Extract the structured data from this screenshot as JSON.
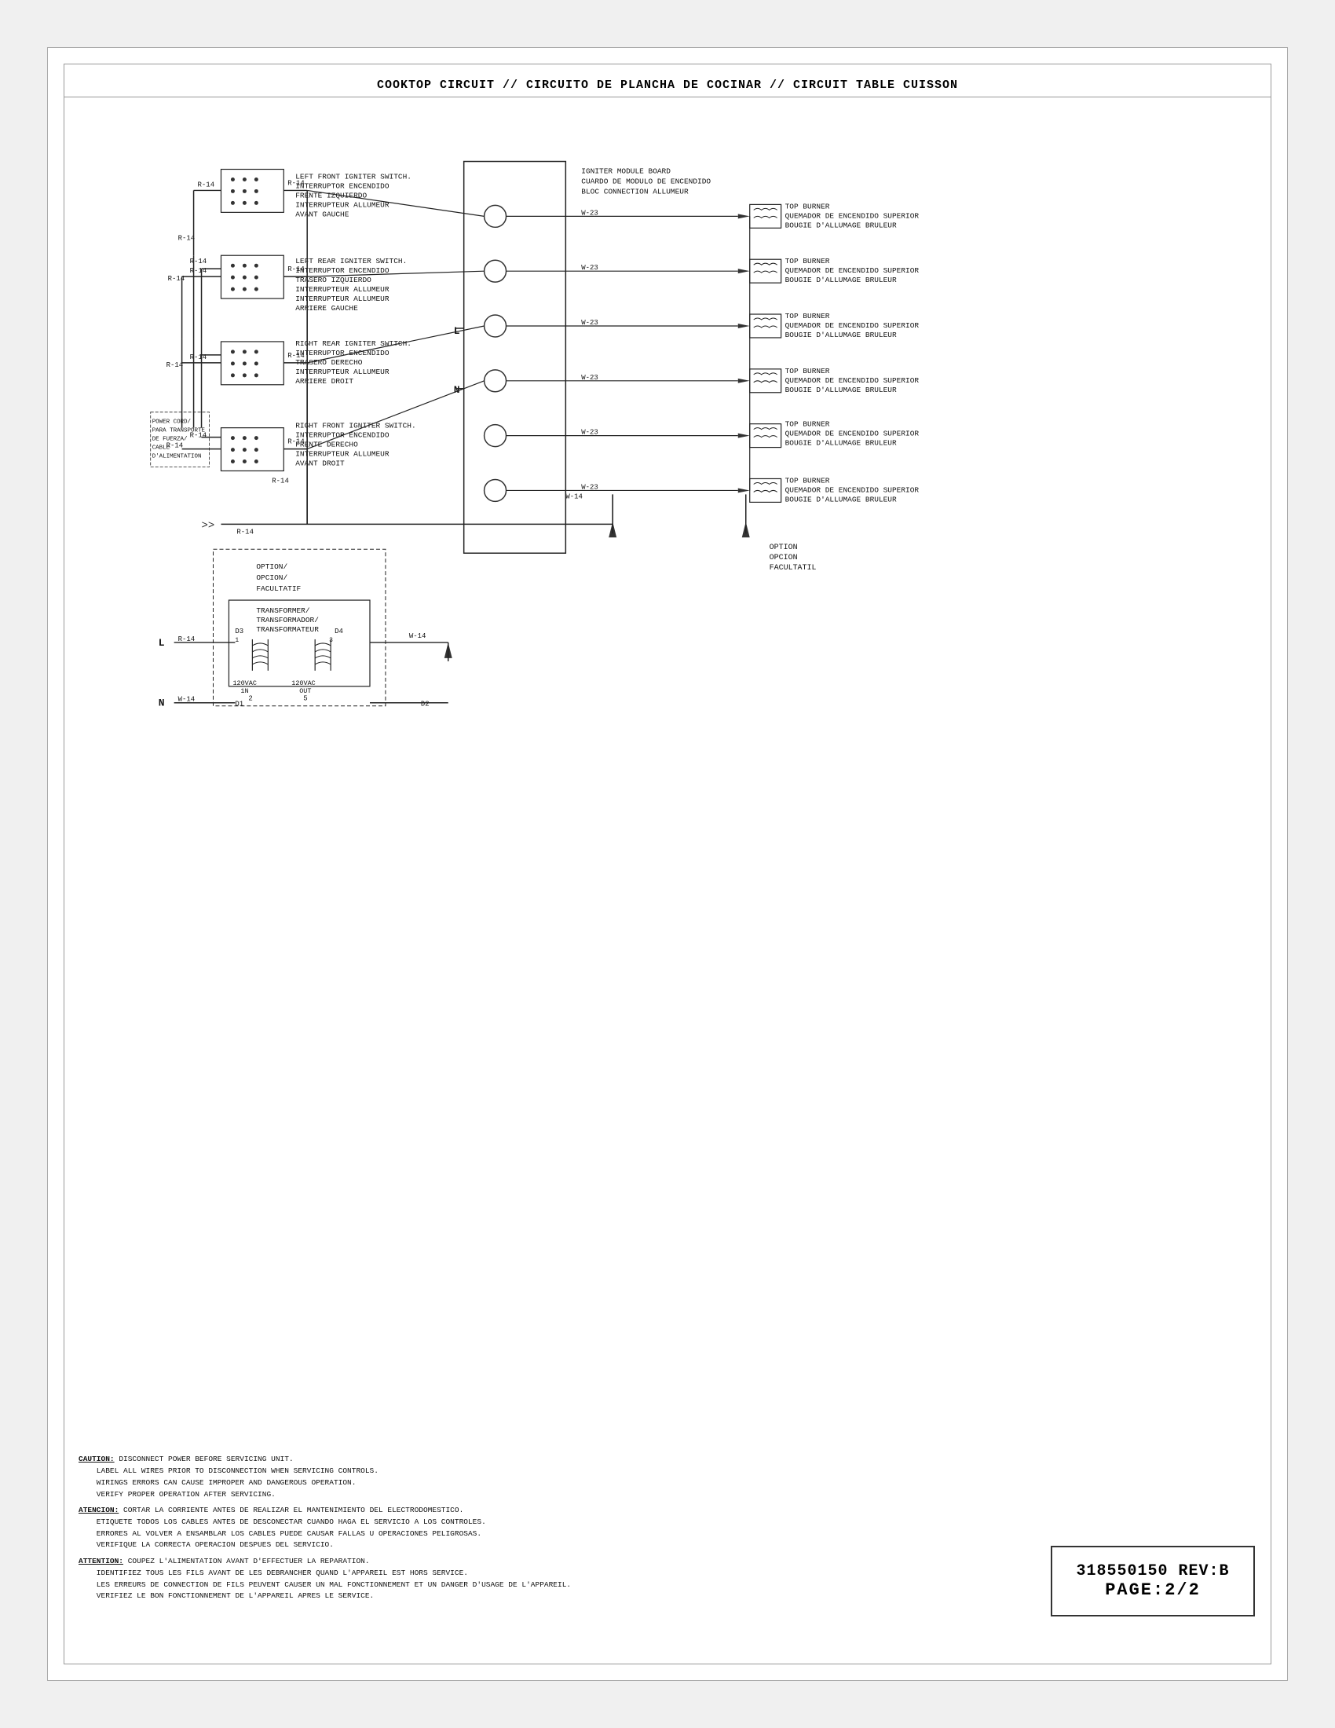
{
  "title": "COOKTOP CIRCUIT // CIRCUITO DE PLANCHA DE COCINAR // CIRCUIT TABLE CUISSON",
  "part_number": "318550150 REV:B",
  "page": "PAGE:2/2",
  "caution_en": "CAUTION: DISCONNECT POWER BEFORE SERVICING UNIT.\n    LABEL ALL WIRES PRIOR TO DISCONNECTION WHEN SERVICING CONTROLS.\n    WIRINGS ERRORS CAN CAUSE IMPROPER AND DANGEROUS OPERATION.\n    VERIFY PROPER OPERATION AFTER SERVICING.",
  "caution_es": "ATENCION: CORTAR LA CORRIENTE ANTES DE REALIZAR EL MANTENIMIENTO DEL ELECTRODOMESTICO.\n    ETIQUETE TODOS LOS CABLES ANTES DE DESCONECTAR CUANDO HAGA EL SERVICIO A LOS CONTROLES.\n    ERRORES AL VOLVER A ENSAMBLAR LOS CABLES PUEDE CAUSAR FALLAS U OPERACIONES PELIGROSAS.\n    VERIFIQUE LA CORRECTA OPERACION DESPUES DEL SERVICIO.",
  "caution_fr": "ATTENTION: COUPEZ L'ALIMENTATION AVANT D'EFFECTUER LA REPARATION.\n    IDENTIFIEZ TOUS LES FILS AVANT DE LES DEBRANCHER QUAND L'APPAREIL EST HORS SERVICE.\n    LES ERREURS DE CONNECTION DE FILS PEUVENT CAUSER UN MAL FONCTIONNEMENT ET UN DANGER D'USAGE DE L'APPAREIL.\n    VERIFIEZ LE BON FONCTIONNEMENT DE L'APPAREIL APRES LE SERVICE."
}
